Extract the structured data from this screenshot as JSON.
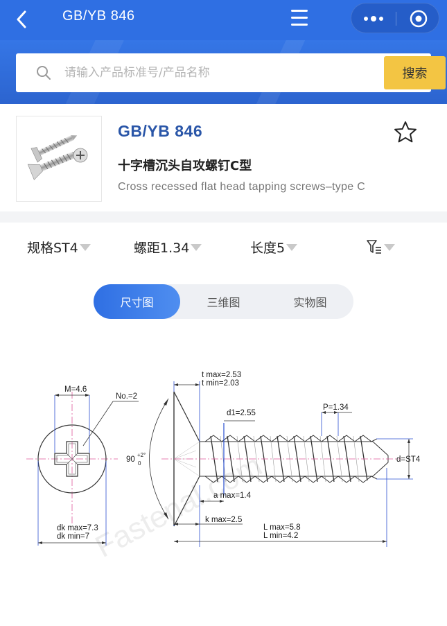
{
  "topbar": {
    "title": "GB/YB 846",
    "back_icon": "chevron-left-icon",
    "menu_icon": "hamburger-icon",
    "more_icon": "more-dots-icon",
    "target_icon": "target-icon"
  },
  "search": {
    "placeholder": "请输入产品标准号/产品名称",
    "button_label": "搜索"
  },
  "product": {
    "code": "GB/YB 846",
    "name_cn": "十字槽沉头自攻螺钉C型",
    "name_en": "Cross recessed flat head tapping screws–type C",
    "favorite_icon": "star-outline-icon"
  },
  "filters": [
    {
      "label": "规格ST4"
    },
    {
      "label": "螺距1.34"
    },
    {
      "label": "长度5"
    },
    {
      "icon": "filter-icon"
    }
  ],
  "tabs": [
    {
      "label": "尺寸图",
      "active": true
    },
    {
      "label": "三维图",
      "active": false
    },
    {
      "label": "实物图",
      "active": false
    }
  ],
  "drawing": {
    "m": "M=4.6",
    "no": "No.=2",
    "dk_max": "dk max=7.3",
    "dk_min": "dk min=7",
    "angle": "90",
    "angle_tol_upper": "+2°",
    "angle_tol_lower": "0",
    "t_max": "t max=2.53",
    "t_min": "t min=2.03",
    "d1": "d1=2.55",
    "p": "P=1.34",
    "d": "d=ST4",
    "a_max": "a max=1.4",
    "k_max": "k max=2.5",
    "l_max": "L max=5.8",
    "l_min": "L min=4.2",
    "watermark": "Fastenal.com"
  },
  "colors": {
    "header_blue": "#2f6fe3",
    "search_button": "#f3c543",
    "code_blue": "#2a56a8",
    "dimension_blue": "#2a4fd0",
    "axis_pink": "#e0559a"
  }
}
